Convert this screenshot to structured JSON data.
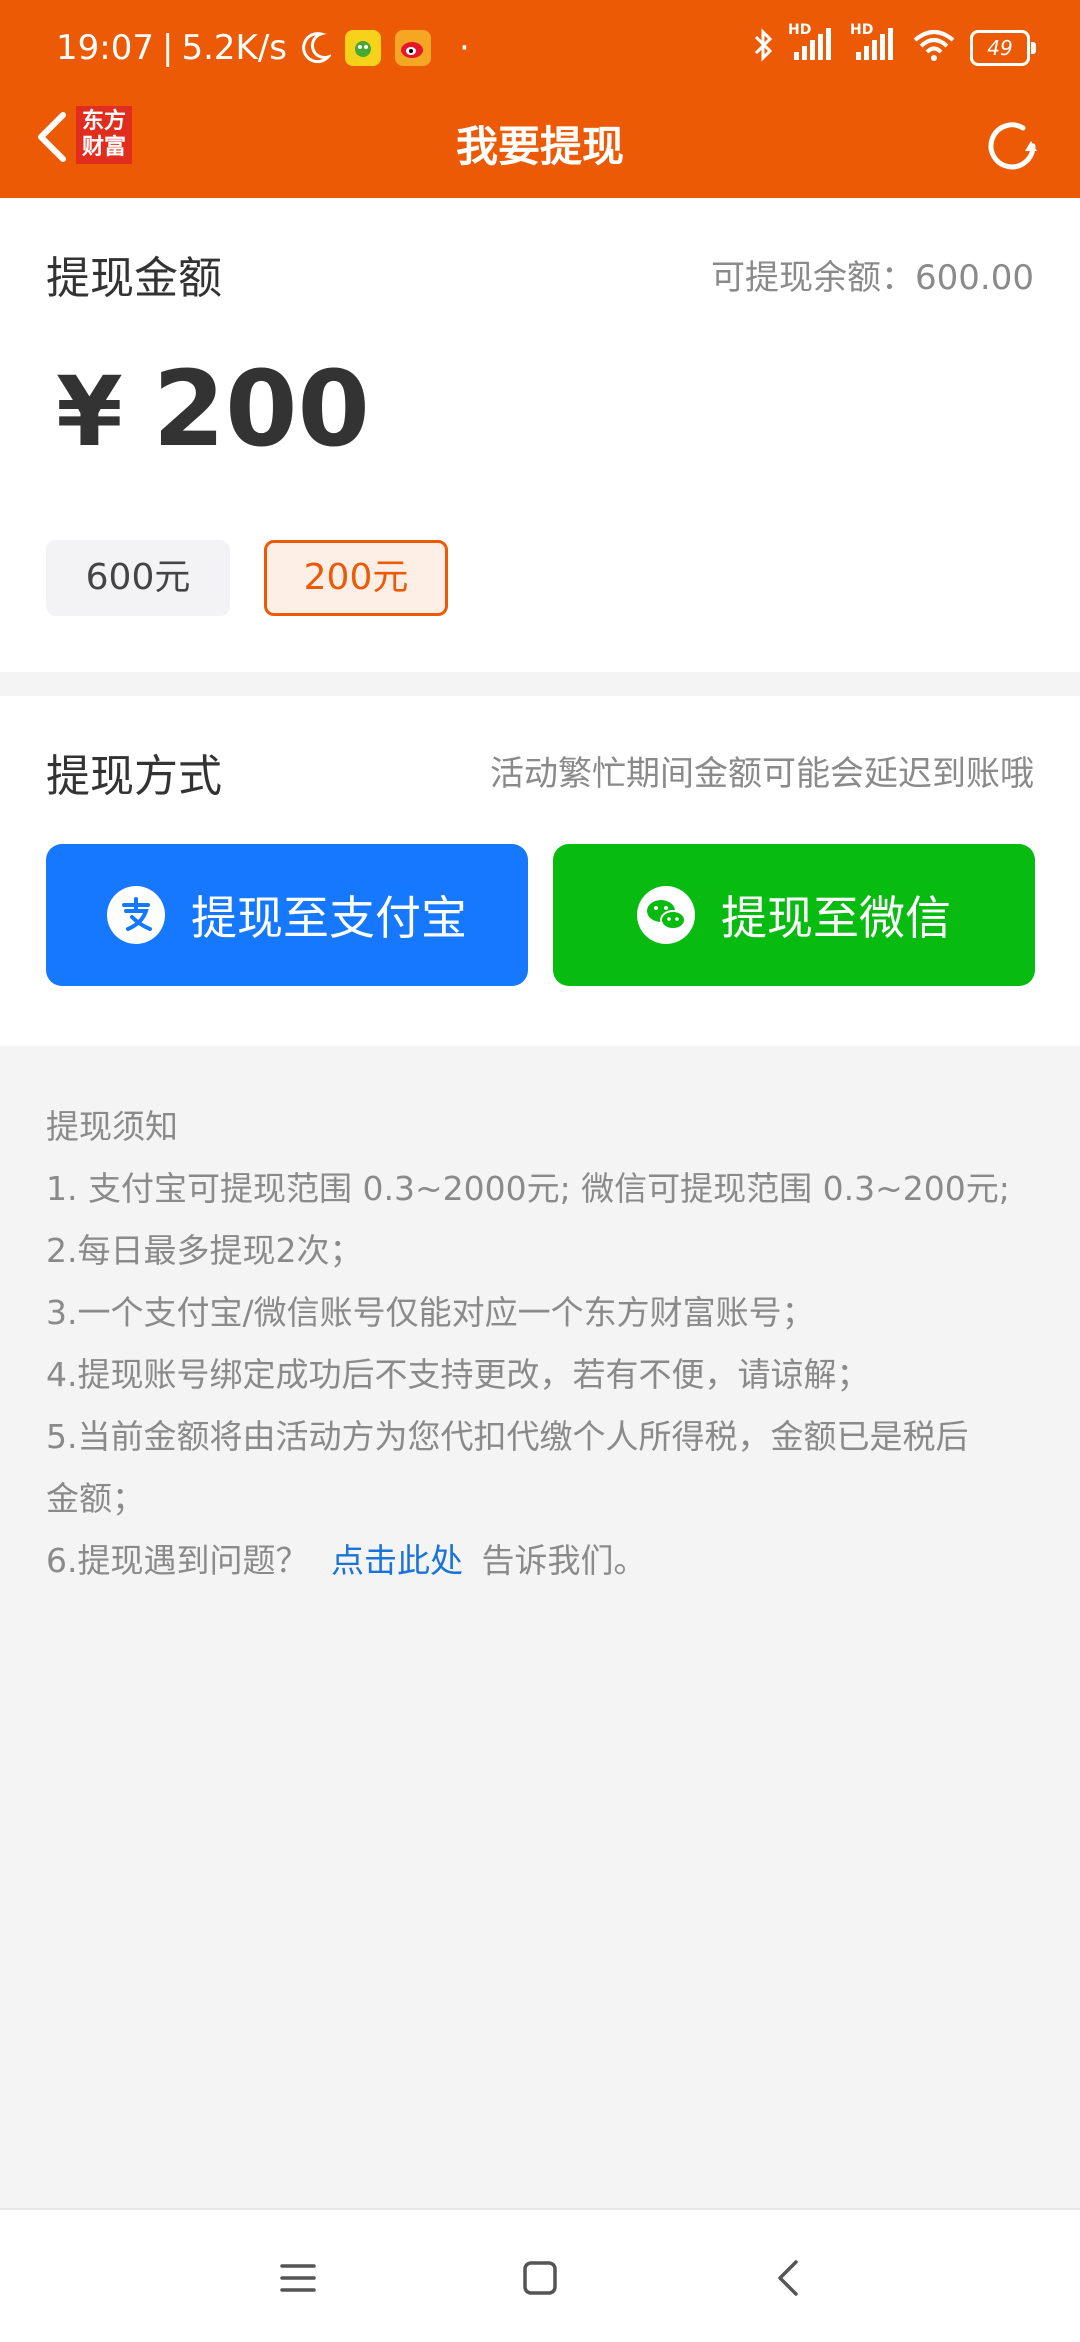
{
  "status_bar": {
    "time": "19:07",
    "speed": "5.2K/s",
    "hd1": "HD",
    "hd2": "HD",
    "battery": "49",
    "dot": "·"
  },
  "nav": {
    "title": "我要提现",
    "logo_line1": "东方",
    "logo_line2": "财富"
  },
  "amount_section": {
    "title": "提现金额",
    "balance_text": "可提现余额：600.00",
    "currency": "¥",
    "amount": "200",
    "chips": [
      {
        "label": "600元",
        "selected": false
      },
      {
        "label": "200元",
        "selected": true
      }
    ]
  },
  "method_section": {
    "title": "提现方式",
    "hint": "活动繁忙期间金额可能会延迟到账哦",
    "alipay_label": "提现至支付宝",
    "wechat_label": "提现至微信"
  },
  "notice": {
    "heading": "提现须知",
    "item1": "1. 支付宝可提现范围 0.3~2000元; 微信可提现范围 0.3~200元;",
    "item2": "2.每日最多提现2次；",
    "item3": "3.一个支付宝/微信账号仅能对应一个东方财富账号；",
    "item4": "4.提现账号绑定成功后不支持更改，若有不便，请谅解；",
    "item5a": "5.当前金额将由活动方为您代扣代缴个人所得税，金额已是税后",
    "item5b": "金额；",
    "item6_prefix": "6.提现遇到问题？",
    "item6_link": "点击此处",
    "item6_suffix": "告诉我们。"
  },
  "colors": {
    "brand_orange": "#ec5a06",
    "alipay_blue": "#1677ff",
    "wechat_green": "#07bb10",
    "link_blue": "#1a73d9"
  },
  "icons": [
    "back-icon",
    "refresh-icon",
    "alipay-icon",
    "wechat-icon",
    "moon-icon",
    "bluetooth-icon",
    "wifi-icon",
    "signal-icon",
    "menu-icon",
    "home-icon",
    "back-nav-icon"
  ]
}
